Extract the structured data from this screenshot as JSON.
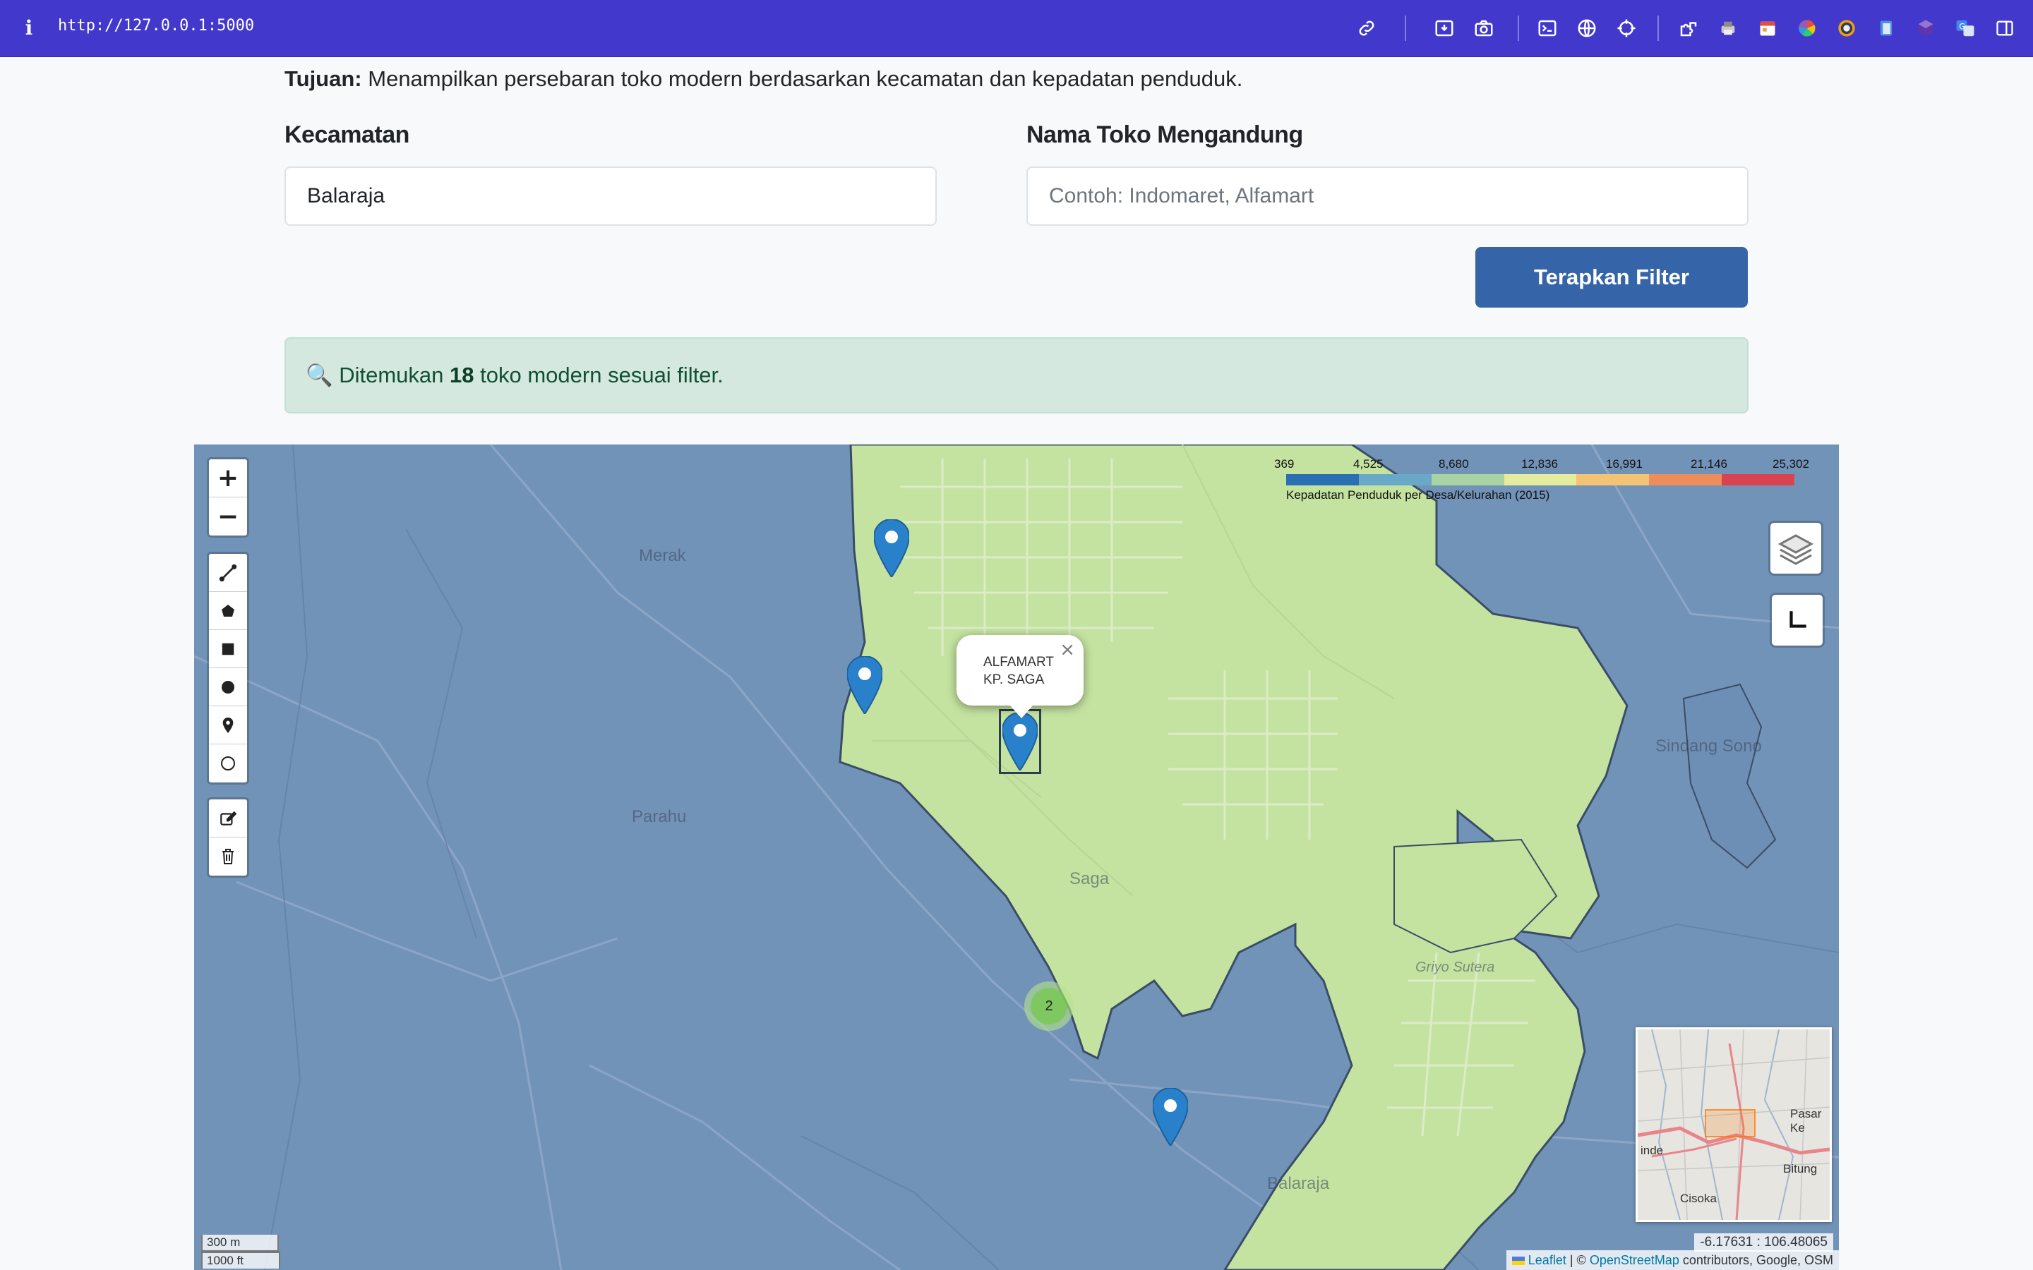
{
  "browser": {
    "url": "http://127.0.0.1:5000",
    "info_icon": "i"
  },
  "page": {
    "purpose_label": "Tujuan:",
    "purpose_text": "Menampilkan persebaran toko modern berdasarkan kecamatan dan kepadatan penduduk.",
    "kecamatan_label": "Kecamatan",
    "kecamatan_value": "Balaraja",
    "toko_label": "Nama Toko Mengandung",
    "toko_placeholder": "Contoh: Indomaret, Alfamart",
    "toko_value": "",
    "apply_button": "Terapkan Filter",
    "result_icon": "🔍",
    "result_prefix": "Ditemukan",
    "result_count": "18",
    "result_suffix": "toko modern sesuai filter."
  },
  "map": {
    "legend": {
      "ticks": [
        "369",
        "4,525",
        "8,680",
        "12,836",
        "16,991",
        "21,146",
        "25,302"
      ],
      "colors": [
        "#2b6fb3",
        "#6aa8c7",
        "#a9d3a2",
        "#e6ec9e",
        "#f4c374",
        "#ee8d5c",
        "#d8434f"
      ],
      "caption": "Kepadatan Penduduk per Desa/Kelurahan (2015)"
    },
    "colors": {
      "low_density": "#6f8fb6",
      "mid_density": "#c4e3a0",
      "marker": "#2a81cb"
    },
    "places": [
      "Merak",
      "Parahu",
      "Saga",
      "Sindang Sono",
      "Balaraja",
      "Griyo Sutera"
    ],
    "popup": {
      "line1": "ALFAMART",
      "line2": "KP. SAGA",
      "close": "×"
    },
    "cluster_count": "2",
    "minimap_labels": [
      "Pasar Ke",
      "inde",
      "Bitung",
      "Cisoka"
    ],
    "scale": {
      "metric": "300 m",
      "imperial": "1000 ft"
    },
    "coords": "-6.17631 : 106.48065",
    "attribution": {
      "leaflet": "Leaflet",
      "sep": "| ©",
      "osm": "OpenStreetMap",
      "rest": "contributors, Google, OSM"
    },
    "zoom_in": "+",
    "zoom_out": "−"
  }
}
